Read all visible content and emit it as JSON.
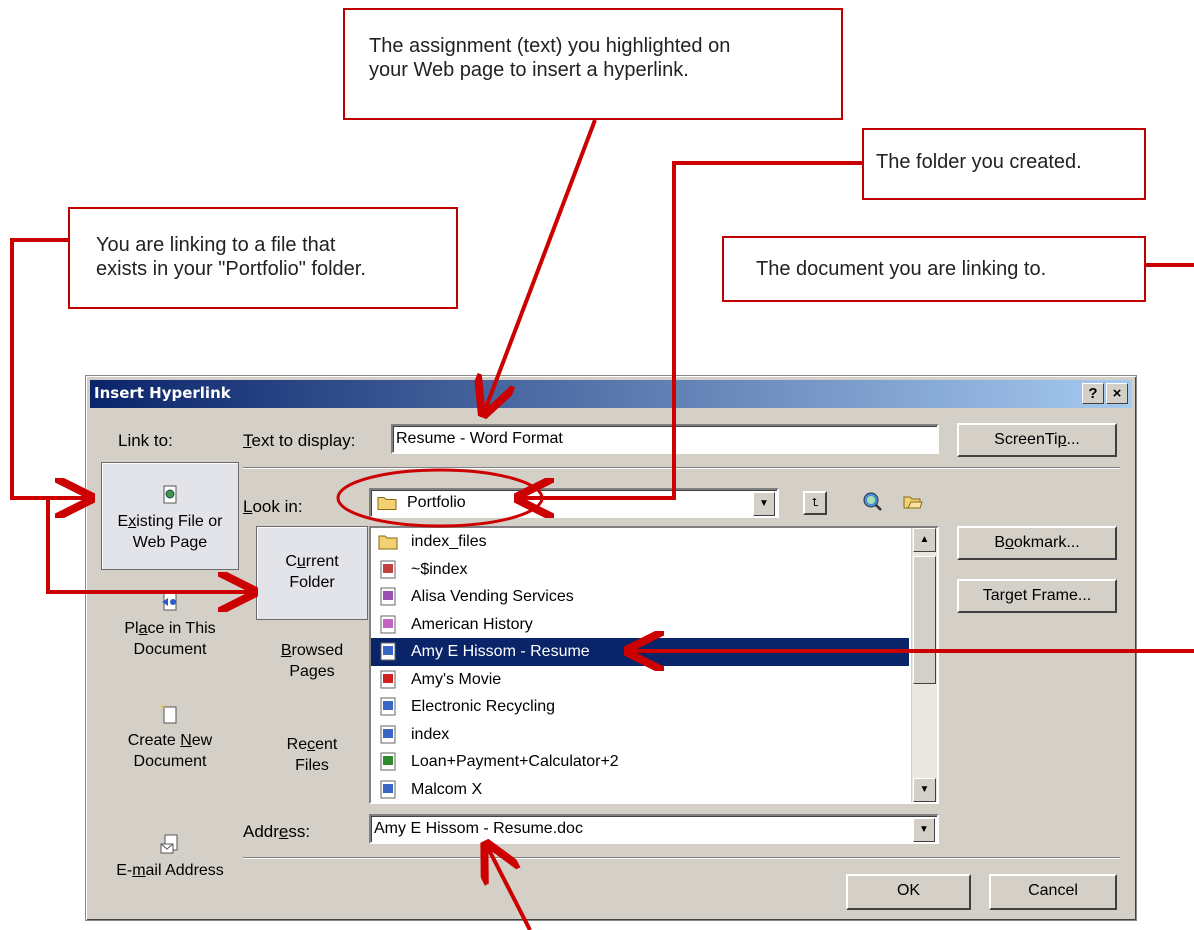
{
  "callouts": {
    "assignment": "The assignment (text) you highlighted on\nyour Web page to insert a hyperlink.",
    "folder": "The folder you created.",
    "linking": "You are linking to a file that\nexists in your \"Portfolio\" folder.",
    "document": "The document you are linking to."
  },
  "dialog": {
    "title": "Insert Hyperlink",
    "help_button": "?",
    "close_button": "×",
    "link_to_label": "Link to:",
    "text_to_display_label_u": "T",
    "text_to_display_label_rest": "ext to display:",
    "text_to_display_value": "Resume -  Word Format",
    "screentip_button_a": "ScreenTi",
    "screentip_button_u": "p",
    "screentip_button_b": "...",
    "look_in_label_u": "L",
    "look_in_label_rest": "ook in:",
    "look_in_value": "Portfolio",
    "address_label_a": "Addr",
    "address_label_u": "e",
    "address_label_b": "ss:",
    "address_value": "Amy E Hissom - Resume.doc",
    "ok_button": "OK",
    "cancel_button": "Cancel",
    "bookmark_button_a": "B",
    "bookmark_button_u": "o",
    "bookmark_button_b": "okmark...",
    "target_frame_button_a": "Tar",
    "target_frame_button_u": "g",
    "target_frame_button_b": "et Frame..."
  },
  "link_to": {
    "existing_a": "E",
    "existing_u": "x",
    "existing_b": "isting File or",
    "existing_c": "Web Page",
    "place_a": "Pl",
    "place_u": "a",
    "place_b": "ce in This",
    "place_c": "Document",
    "create_a": "Create ",
    "create_u": "N",
    "create_b": "ew",
    "create_c": "Document",
    "email_a": "E-",
    "email_u": "m",
    "email_b": "ail Address"
  },
  "sub_nav": {
    "current_a": "C",
    "current_u": "u",
    "current_b": "rrent",
    "current_c": "Folder",
    "browsed_u": "B",
    "browsed_a": "rowsed",
    "browsed_c": "Pages",
    "recent_a": "Re",
    "recent_u": "c",
    "recent_b": "ent",
    "recent_c": "Files"
  },
  "files": [
    {
      "name": "index_files",
      "icon": "folder-icon",
      "color": "#f2d073"
    },
    {
      "name": "~$index",
      "icon": "generic-file-icon",
      "color": "#c04040"
    },
    {
      "name": "Alisa Vending Services",
      "icon": "publisher-file-icon",
      "color": "#9a4fb5"
    },
    {
      "name": "American History",
      "icon": "page-file-icon",
      "color": "#c064c0"
    },
    {
      "name": "Amy E Hissom - Resume",
      "icon": "word-doc-icon",
      "color": "#3a66c4",
      "selected": true
    },
    {
      "name": "Amy's Movie",
      "icon": "movie-icon",
      "color": "#d02020"
    },
    {
      "name": "Electronic Recycling",
      "icon": "web-page-icon",
      "color": "#3a66c4"
    },
    {
      "name": "index",
      "icon": "word-doc-icon",
      "color": "#3a66c4"
    },
    {
      "name": "Loan+Payment+Calculator+2",
      "icon": "excel-file-icon",
      "color": "#2f8a2f"
    },
    {
      "name": "Malcom X",
      "icon": "word-doc-icon",
      "color": "#3a66c4"
    }
  ],
  "colors": {
    "callout_border": "#c00000",
    "arrow": "#cc0000",
    "dialog_face": "#d4d0c8",
    "titlebar_start": "#0a246a",
    "titlebar_end": "#a6caf0",
    "selection": "#0a246a"
  }
}
